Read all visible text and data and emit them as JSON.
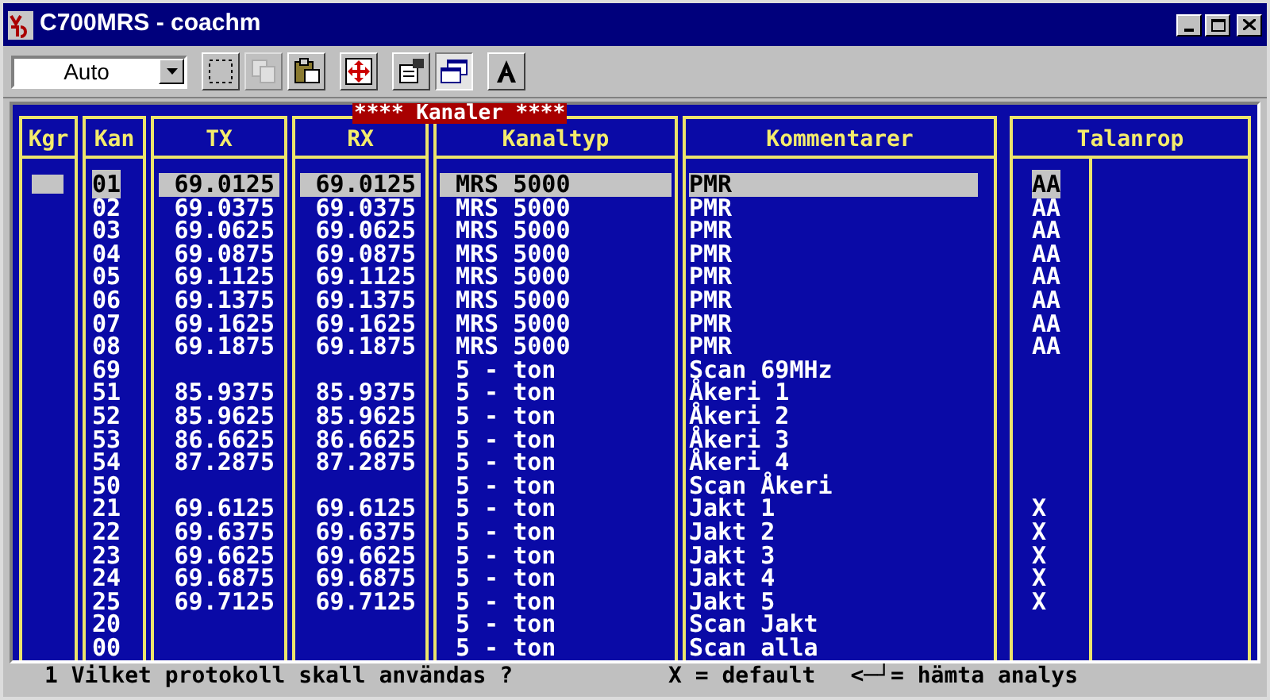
{
  "window": {
    "title": "C700MRS - coachm"
  },
  "toolbar": {
    "combo": {
      "value": "Auto"
    },
    "tools": [
      {
        "kind": "select",
        "disabled": false,
        "pressed": false
      },
      {
        "kind": "copy",
        "disabled": true,
        "pressed": false
      },
      {
        "kind": "paste",
        "disabled": false,
        "pressed": false
      },
      {
        "kind": "fullscreen",
        "disabled": false,
        "pressed": false
      },
      {
        "kind": "properties",
        "disabled": false,
        "pressed": false
      },
      {
        "kind": "window",
        "disabled": false,
        "pressed": true
      },
      {
        "kind": "font",
        "disabled": false,
        "pressed": false
      }
    ]
  },
  "panel": {
    "title": "**** Kanaler ****",
    "columns": {
      "kgr": "Kgr",
      "kan": "Kan",
      "tx": "TX",
      "rx": "RX",
      "type": "Kanaltyp",
      "comment": "Kommentarer",
      "talanrop": "Talanrop"
    },
    "rows": [
      {
        "kan": "01",
        "tx": "69.0125",
        "rx": "69.0125",
        "type": "MRS 5000",
        "comment": "PMR",
        "talanrop": "AA",
        "selected": true
      },
      {
        "kan": "02",
        "tx": "69.0375",
        "rx": "69.0375",
        "type": "MRS 5000",
        "comment": "PMR",
        "talanrop": "AA",
        "selected": false
      },
      {
        "kan": "03",
        "tx": "69.0625",
        "rx": "69.0625",
        "type": "MRS 5000",
        "comment": "PMR",
        "talanrop": "AA",
        "selected": false
      },
      {
        "kan": "04",
        "tx": "69.0875",
        "rx": "69.0875",
        "type": "MRS 5000",
        "comment": "PMR",
        "talanrop": "AA",
        "selected": false
      },
      {
        "kan": "05",
        "tx": "69.1125",
        "rx": "69.1125",
        "type": "MRS 5000",
        "comment": "PMR",
        "talanrop": "AA",
        "selected": false
      },
      {
        "kan": "06",
        "tx": "69.1375",
        "rx": "69.1375",
        "type": "MRS 5000",
        "comment": "PMR",
        "talanrop": "AA",
        "selected": false
      },
      {
        "kan": "07",
        "tx": "69.1625",
        "rx": "69.1625",
        "type": "MRS 5000",
        "comment": "PMR",
        "talanrop": "AA",
        "selected": false
      },
      {
        "kan": "08",
        "tx": "69.1875",
        "rx": "69.1875",
        "type": "MRS 5000",
        "comment": "PMR",
        "talanrop": "AA",
        "selected": false
      },
      {
        "kan": "69",
        "type": "5 - ton",
        "comment": "Scan 69MHz",
        "selected": false
      },
      {
        "kan": "51",
        "tx": "85.9375",
        "rx": "85.9375",
        "type": "5 - ton",
        "comment": "Åkeri 1",
        "selected": false
      },
      {
        "kan": "52",
        "tx": "85.9625",
        "rx": "85.9625",
        "type": "5 - ton",
        "comment": "Åkeri 2",
        "selected": false
      },
      {
        "kan": "53",
        "tx": "86.6625",
        "rx": "86.6625",
        "type": "5 - ton",
        "comment": "Åkeri 3",
        "selected": false
      },
      {
        "kan": "54",
        "tx": "87.2875",
        "rx": "87.2875",
        "type": "5 - ton",
        "comment": "Åkeri 4",
        "selected": false
      },
      {
        "kan": "50",
        "type": "5 - ton",
        "comment": "Scan Åkeri",
        "selected": false
      },
      {
        "kan": "21",
        "tx": "69.6125",
        "rx": "69.6125",
        "type": "5 - ton",
        "comment": "Jakt 1",
        "talanrop": "X",
        "selected": false
      },
      {
        "kan": "22",
        "tx": "69.6375",
        "rx": "69.6375",
        "type": "5 - ton",
        "comment": "Jakt 2",
        "talanrop": "X",
        "selected": false
      },
      {
        "kan": "23",
        "tx": "69.6625",
        "rx": "69.6625",
        "type": "5 - ton",
        "comment": "Jakt 3",
        "talanrop": "X",
        "selected": false
      },
      {
        "kan": "24",
        "tx": "69.6875",
        "rx": "69.6875",
        "type": "5 - ton",
        "comment": "Jakt 4",
        "talanrop": "X",
        "selected": false
      },
      {
        "kan": "25",
        "tx": "69.7125",
        "rx": "69.7125",
        "type": "5 - ton",
        "comment": "Jakt 5",
        "talanrop": "X",
        "selected": false
      },
      {
        "kan": "20",
        "type": "5 - ton",
        "comment": "Scan Jakt",
        "selected": false
      },
      {
        "kan": "00",
        "type": "5 - ton",
        "comment": "Scan alla",
        "selected": false
      }
    ]
  },
  "status_bar": {
    "prompt": "1 Vilket protokoll skall användas ?",
    "hint_default": "X = default",
    "hint_enter": "<─┘= hämta analys"
  }
}
